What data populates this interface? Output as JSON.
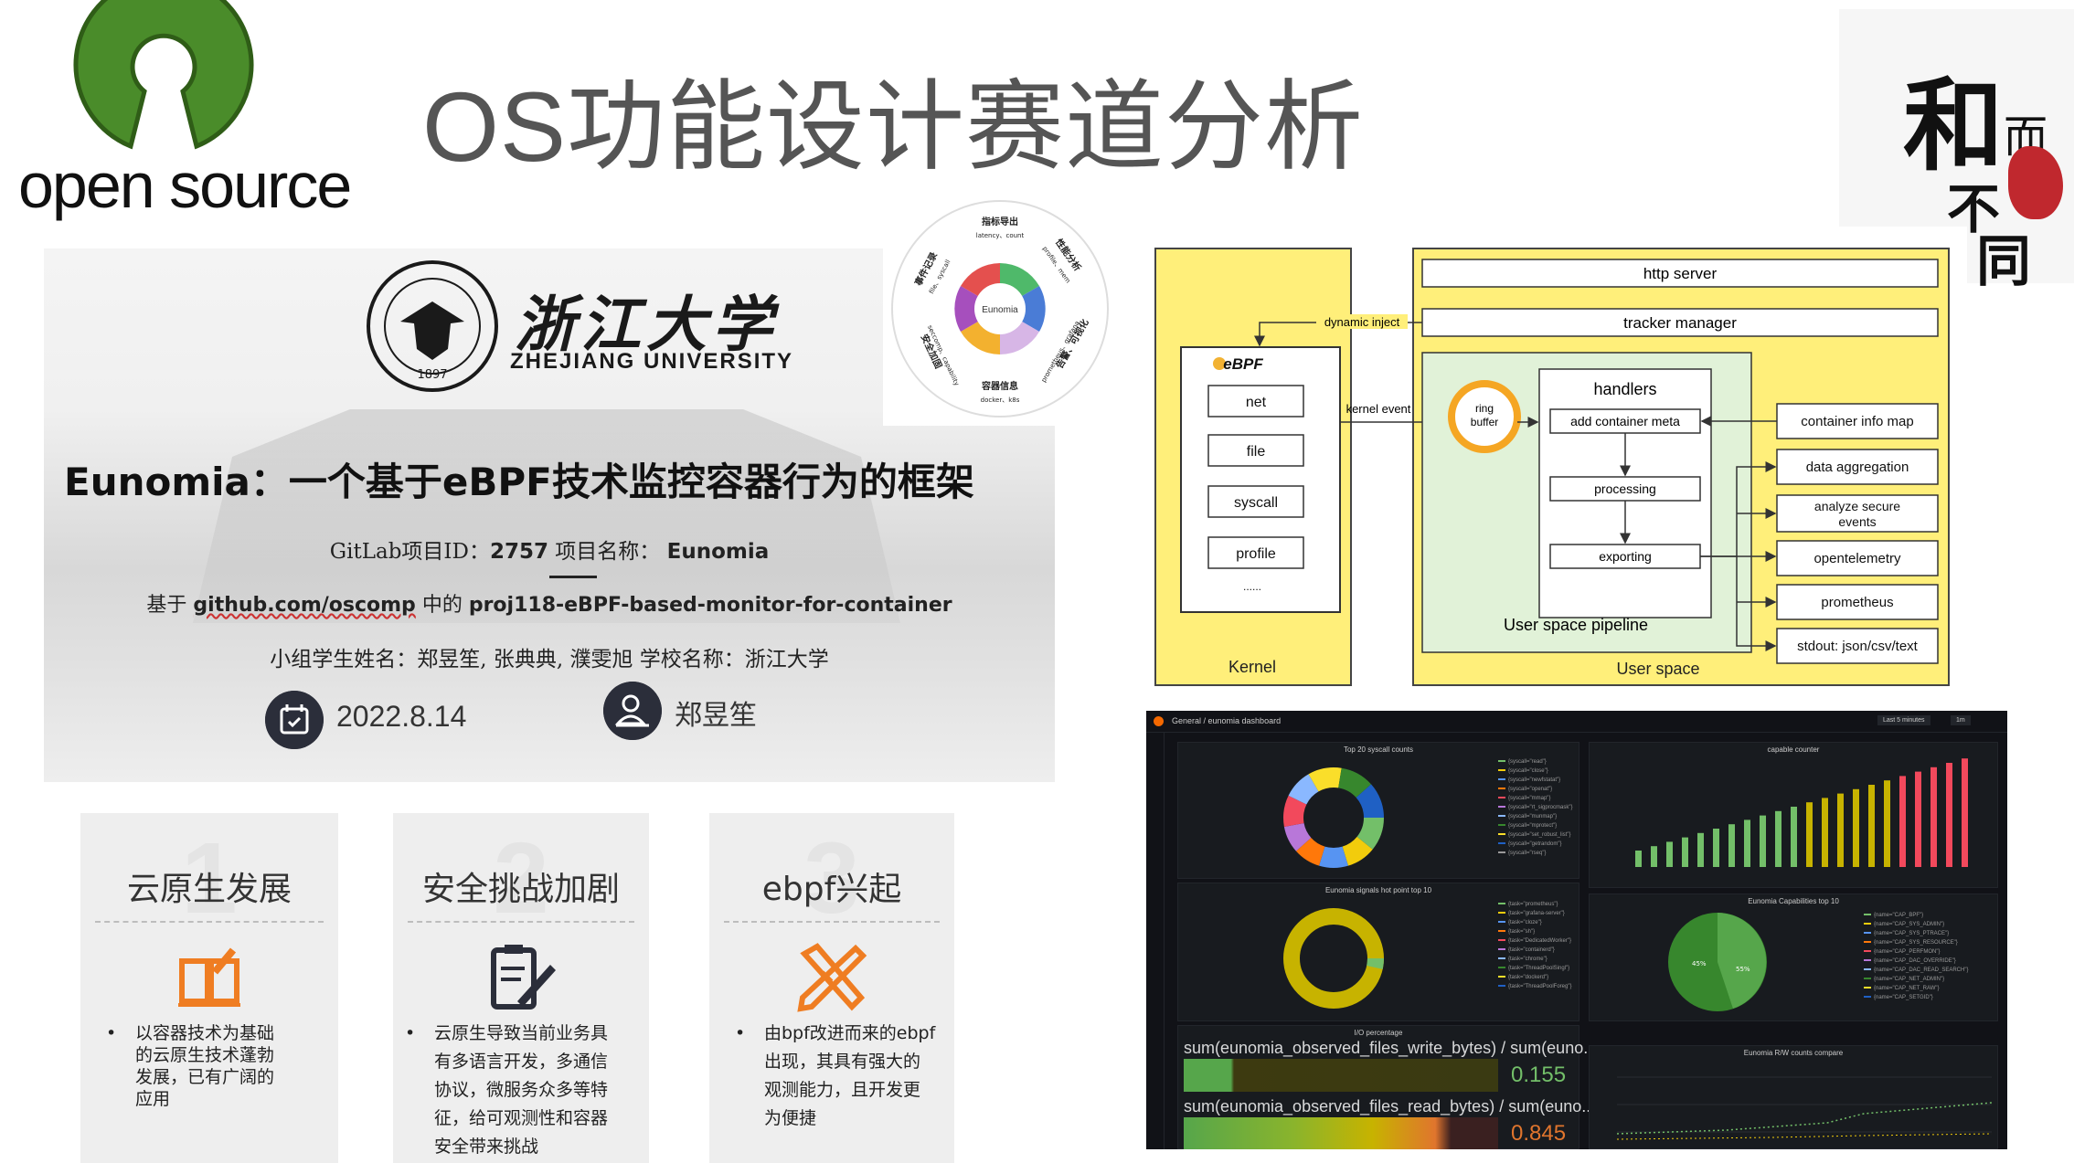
{
  "page": {
    "title": "OS功能设计赛道分析",
    "logo_text": "open source",
    "badge_chars": [
      "和",
      "而",
      "不",
      "同"
    ]
  },
  "slide": {
    "university_cn": "浙江大学",
    "university_en": "ZHEJIANG UNIVERSITY",
    "emblem_year": "1897",
    "title": "Eunomia：一个基于eBPF技术监控容器行为的框架",
    "gitlab_prefix": "GitLab项目ID：",
    "gitlab_id": "2757",
    "project_name_label": "项目名称：",
    "project_name": "Eunomia",
    "based_prefix": "基于",
    "based_repo": "github.com/oscomp",
    "based_mid": "中的",
    "based_project": "proj118-eBPF-based-monitor-for-container",
    "members": "小组学生姓名：郑昱笙, 张典典, 濮雯旭   学校名称：浙江大学",
    "date": "2022.8.14",
    "presenter": "郑昱笙"
  },
  "wheel": {
    "center": "Eunomia",
    "segments": [
      {
        "title": "指标导出",
        "sub": "latency、count"
      },
      {
        "title": "性能分析",
        "sub": "profile、mem"
      },
      {
        "title": "告警、可视化",
        "sub": "prometheus、grafana"
      },
      {
        "title": "容器信息",
        "sub": "docker、k8s"
      },
      {
        "title": "安全加固",
        "sub": "seccomp、capability"
      },
      {
        "title": "事件记录",
        "sub": "file、syscall"
      }
    ]
  },
  "arch": {
    "kernel_label": "Kernel",
    "ebpf_label": "eBPF",
    "ebpf_items": [
      "net",
      "file",
      "syscall",
      "profile",
      "......"
    ],
    "dynamic_inject": "dynamic inject",
    "kernel_event": "kernel event",
    "ring_buffer": "ring buffer",
    "http_server": "http server",
    "tracker_manager": "tracker manager",
    "handlers": "handlers",
    "add_container_meta": "add container meta",
    "processing": "processing",
    "exporting": "exporting",
    "pipeline_label": "User space pipeline",
    "user_space_label": "User space",
    "outputs": [
      "container info map",
      "data aggregation",
      "analyze secure events",
      "opentelemetry",
      "prometheus",
      "stdout: json/csv/text"
    ]
  },
  "grafana": {
    "breadcrumb": "General / eunomia dashboard",
    "time_range": "Last 5 minutes",
    "refresh": "1m",
    "panels": {
      "syscall": "Top 20 syscall counts",
      "capable": "capable counter",
      "signals": "Eunomia signals hot point top 10",
      "caps": "Eunomia Capabilities top 10",
      "io": "I/O percentage",
      "rw": "Eunomia R/W counts compare"
    },
    "io_rows": [
      {
        "label": "sum(eunomia_observed_files_write_bytes) / sum(euno...",
        "value": "0.155"
      },
      {
        "label": "sum(eunomia_observed_files_read_bytes) / sum(euno...",
        "value": "0.845"
      }
    ],
    "pie_pct": [
      "45%",
      "55%"
    ]
  },
  "cards": [
    {
      "num": "1",
      "title": "云原生发展",
      "icon": "book-icon",
      "body": [
        "以容器技术为基础",
        "的云原生技术蓬勃",
        "发展，已有广阔的",
        "应用"
      ]
    },
    {
      "num": "2",
      "title": "安全挑战加剧",
      "icon": "clipboard-icon",
      "body": [
        "云原生导致当前业务具",
        "有多语言开发，多通信",
        "协议，微服务众多等特",
        "征，给可观测性和容器",
        "安全带来挑战"
      ]
    },
    {
      "num": "3",
      "title": "ebpf兴起",
      "icon": "tools-icon",
      "body": [
        "由bpf改进而来的ebpf",
        "出现，其具有强大的",
        "观测能力，且开发更",
        "为便捷"
      ]
    }
  ],
  "colors": {
    "logo_green": "#4a8c2a",
    "arch_yellow": "#ffef7a",
    "arch_green": "#e1f2d8",
    "ring_orange": "#f5a623",
    "card_orange": "#ef7d22",
    "card_gray": "#eeeeee"
  }
}
